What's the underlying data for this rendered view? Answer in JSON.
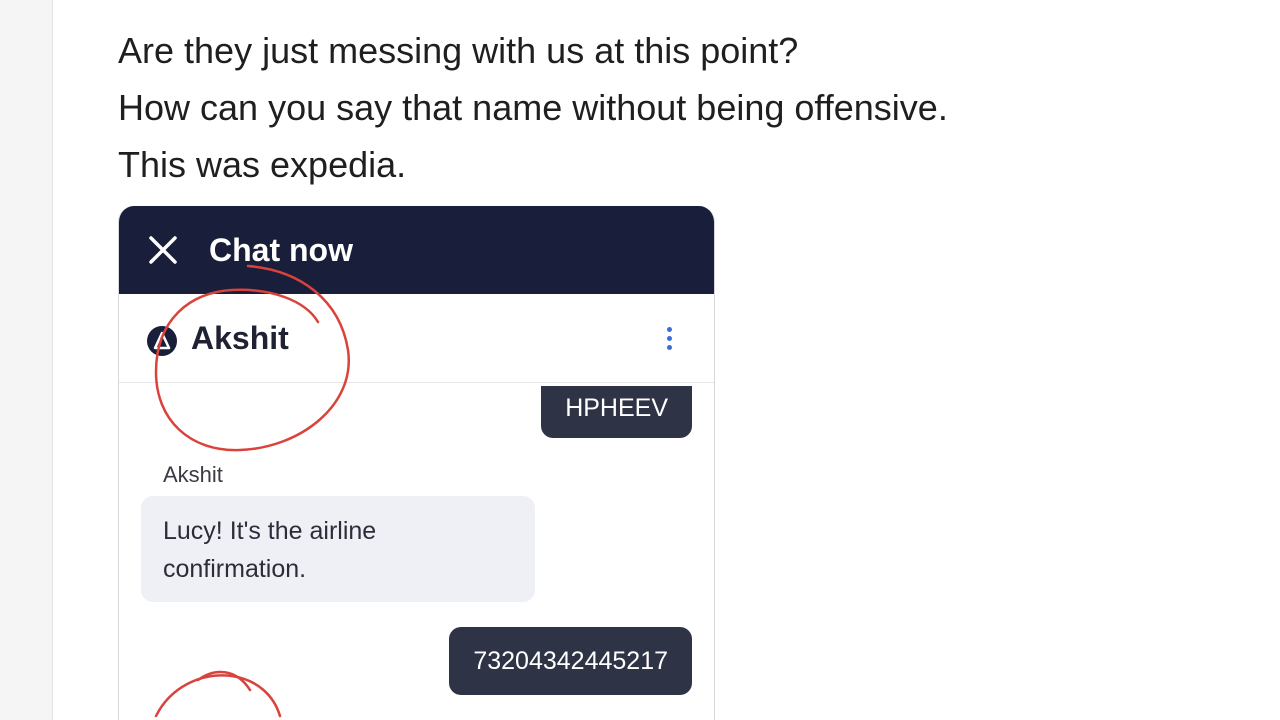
{
  "post": {
    "lines": [
      "Are they just messing with us at this point?",
      "How can you say that name without being offensive.",
      "This was expedia."
    ]
  },
  "chat": {
    "title": "Chat now",
    "agent_name": "Akshit",
    "messages": [
      {
        "from": "user",
        "text": "HPHEEV"
      },
      {
        "from": "agent",
        "sender": "Akshit",
        "text": "Lucy! It's the airline confirmation."
      },
      {
        "from": "user",
        "text": "73204342445217"
      }
    ]
  },
  "colors": {
    "header_bg": "#191e3b",
    "user_bubble": "#2f3346",
    "agent_bubble": "#eef0f6",
    "annotation": "#d9433c",
    "kebab": "#3c6dd6"
  },
  "icons": {
    "close": "close-icon",
    "more": "kebab-menu-icon",
    "avatar": "agent-avatar-icon"
  }
}
